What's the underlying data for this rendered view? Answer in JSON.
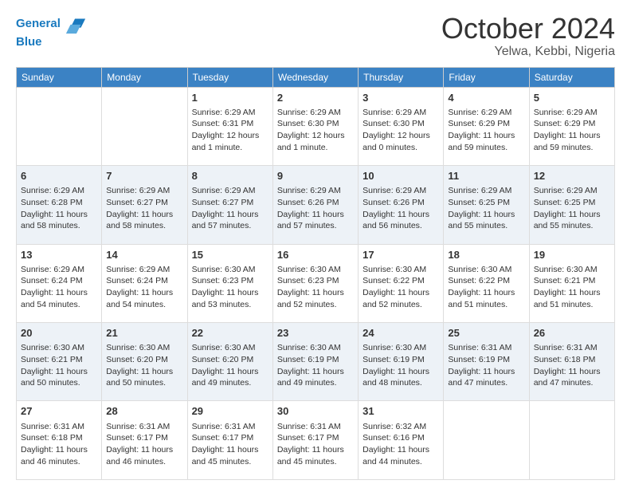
{
  "header": {
    "logo_line1": "General",
    "logo_line2": "Blue",
    "title": "October 2024",
    "subtitle": "Yelwa, Kebbi, Nigeria"
  },
  "days_of_week": [
    "Sunday",
    "Monday",
    "Tuesday",
    "Wednesday",
    "Thursday",
    "Friday",
    "Saturday"
  ],
  "weeks": [
    [
      {
        "day": "",
        "sunrise": "",
        "sunset": "",
        "daylight": ""
      },
      {
        "day": "",
        "sunrise": "",
        "sunset": "",
        "daylight": ""
      },
      {
        "day": "1",
        "sunrise": "Sunrise: 6:29 AM",
        "sunset": "Sunset: 6:31 PM",
        "daylight": "Daylight: 12 hours and 1 minute."
      },
      {
        "day": "2",
        "sunrise": "Sunrise: 6:29 AM",
        "sunset": "Sunset: 6:30 PM",
        "daylight": "Daylight: 12 hours and 1 minute."
      },
      {
        "day": "3",
        "sunrise": "Sunrise: 6:29 AM",
        "sunset": "Sunset: 6:30 PM",
        "daylight": "Daylight: 12 hours and 0 minutes."
      },
      {
        "day": "4",
        "sunrise": "Sunrise: 6:29 AM",
        "sunset": "Sunset: 6:29 PM",
        "daylight": "Daylight: 11 hours and 59 minutes."
      },
      {
        "day": "5",
        "sunrise": "Sunrise: 6:29 AM",
        "sunset": "Sunset: 6:29 PM",
        "daylight": "Daylight: 11 hours and 59 minutes."
      }
    ],
    [
      {
        "day": "6",
        "sunrise": "Sunrise: 6:29 AM",
        "sunset": "Sunset: 6:28 PM",
        "daylight": "Daylight: 11 hours and 58 minutes."
      },
      {
        "day": "7",
        "sunrise": "Sunrise: 6:29 AM",
        "sunset": "Sunset: 6:27 PM",
        "daylight": "Daylight: 11 hours and 58 minutes."
      },
      {
        "day": "8",
        "sunrise": "Sunrise: 6:29 AM",
        "sunset": "Sunset: 6:27 PM",
        "daylight": "Daylight: 11 hours and 57 minutes."
      },
      {
        "day": "9",
        "sunrise": "Sunrise: 6:29 AM",
        "sunset": "Sunset: 6:26 PM",
        "daylight": "Daylight: 11 hours and 57 minutes."
      },
      {
        "day": "10",
        "sunrise": "Sunrise: 6:29 AM",
        "sunset": "Sunset: 6:26 PM",
        "daylight": "Daylight: 11 hours and 56 minutes."
      },
      {
        "day": "11",
        "sunrise": "Sunrise: 6:29 AM",
        "sunset": "Sunset: 6:25 PM",
        "daylight": "Daylight: 11 hours and 55 minutes."
      },
      {
        "day": "12",
        "sunrise": "Sunrise: 6:29 AM",
        "sunset": "Sunset: 6:25 PM",
        "daylight": "Daylight: 11 hours and 55 minutes."
      }
    ],
    [
      {
        "day": "13",
        "sunrise": "Sunrise: 6:29 AM",
        "sunset": "Sunset: 6:24 PM",
        "daylight": "Daylight: 11 hours and 54 minutes."
      },
      {
        "day": "14",
        "sunrise": "Sunrise: 6:29 AM",
        "sunset": "Sunset: 6:24 PM",
        "daylight": "Daylight: 11 hours and 54 minutes."
      },
      {
        "day": "15",
        "sunrise": "Sunrise: 6:30 AM",
        "sunset": "Sunset: 6:23 PM",
        "daylight": "Daylight: 11 hours and 53 minutes."
      },
      {
        "day": "16",
        "sunrise": "Sunrise: 6:30 AM",
        "sunset": "Sunset: 6:23 PM",
        "daylight": "Daylight: 11 hours and 52 minutes."
      },
      {
        "day": "17",
        "sunrise": "Sunrise: 6:30 AM",
        "sunset": "Sunset: 6:22 PM",
        "daylight": "Daylight: 11 hours and 52 minutes."
      },
      {
        "day": "18",
        "sunrise": "Sunrise: 6:30 AM",
        "sunset": "Sunset: 6:22 PM",
        "daylight": "Daylight: 11 hours and 51 minutes."
      },
      {
        "day": "19",
        "sunrise": "Sunrise: 6:30 AM",
        "sunset": "Sunset: 6:21 PM",
        "daylight": "Daylight: 11 hours and 51 minutes."
      }
    ],
    [
      {
        "day": "20",
        "sunrise": "Sunrise: 6:30 AM",
        "sunset": "Sunset: 6:21 PM",
        "daylight": "Daylight: 11 hours and 50 minutes."
      },
      {
        "day": "21",
        "sunrise": "Sunrise: 6:30 AM",
        "sunset": "Sunset: 6:20 PM",
        "daylight": "Daylight: 11 hours and 50 minutes."
      },
      {
        "day": "22",
        "sunrise": "Sunrise: 6:30 AM",
        "sunset": "Sunset: 6:20 PM",
        "daylight": "Daylight: 11 hours and 49 minutes."
      },
      {
        "day": "23",
        "sunrise": "Sunrise: 6:30 AM",
        "sunset": "Sunset: 6:19 PM",
        "daylight": "Daylight: 11 hours and 49 minutes."
      },
      {
        "day": "24",
        "sunrise": "Sunrise: 6:30 AM",
        "sunset": "Sunset: 6:19 PM",
        "daylight": "Daylight: 11 hours and 48 minutes."
      },
      {
        "day": "25",
        "sunrise": "Sunrise: 6:31 AM",
        "sunset": "Sunset: 6:19 PM",
        "daylight": "Daylight: 11 hours and 47 minutes."
      },
      {
        "day": "26",
        "sunrise": "Sunrise: 6:31 AM",
        "sunset": "Sunset: 6:18 PM",
        "daylight": "Daylight: 11 hours and 47 minutes."
      }
    ],
    [
      {
        "day": "27",
        "sunrise": "Sunrise: 6:31 AM",
        "sunset": "Sunset: 6:18 PM",
        "daylight": "Daylight: 11 hours and 46 minutes."
      },
      {
        "day": "28",
        "sunrise": "Sunrise: 6:31 AM",
        "sunset": "Sunset: 6:17 PM",
        "daylight": "Daylight: 11 hours and 46 minutes."
      },
      {
        "day": "29",
        "sunrise": "Sunrise: 6:31 AM",
        "sunset": "Sunset: 6:17 PM",
        "daylight": "Daylight: 11 hours and 45 minutes."
      },
      {
        "day": "30",
        "sunrise": "Sunrise: 6:31 AM",
        "sunset": "Sunset: 6:17 PM",
        "daylight": "Daylight: 11 hours and 45 minutes."
      },
      {
        "day": "31",
        "sunrise": "Sunrise: 6:32 AM",
        "sunset": "Sunset: 6:16 PM",
        "daylight": "Daylight: 11 hours and 44 minutes."
      },
      {
        "day": "",
        "sunrise": "",
        "sunset": "",
        "daylight": ""
      },
      {
        "day": "",
        "sunrise": "",
        "sunset": "",
        "daylight": ""
      }
    ]
  ]
}
